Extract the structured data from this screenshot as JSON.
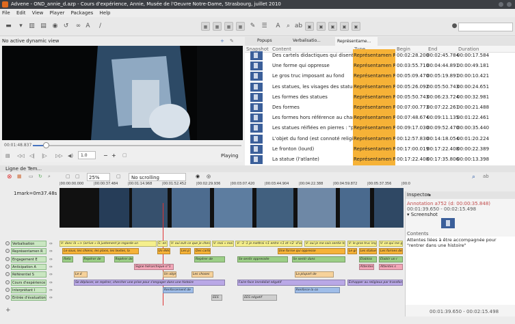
{
  "window": {
    "title": "Advene - OND_annie_d.azp - Cours d'expérience, Annie, Musée de l'Oeuvre Notre-Dame, Strasbourg, juillet 2010"
  },
  "menu": [
    "File",
    "Edit",
    "View",
    "Player",
    "Packages",
    "Help"
  ],
  "dynamic_view": "No active dynamic view",
  "tabs": {
    "popups": "Popups",
    "verbalisation": "Verbalisatio...",
    "representation": "Représentame..."
  },
  "video": {
    "time": "00:01:48.837",
    "rate": "1.0",
    "status": "Playing"
  },
  "annotations_table": {
    "headers": [
      "Snapshot",
      "Content",
      "Type",
      "Begin",
      "End",
      "Duration"
    ],
    "rows": [
      {
        "content": "Des cartels didactiques qui disent de",
        "type": "Représentamen R",
        "begin": "00:02:28.200",
        "end": "00:02:45.784",
        "duration": "00:00:17.584"
      },
      {
        "content": "Une forme qui oppresse",
        "type": "Représentamen R",
        "begin": "00:03:55.710",
        "end": "00:04:44.891",
        "duration": "00:00:49.181"
      },
      {
        "content": "Le gros truc imposant au fond",
        "type": "Représentamen R",
        "begin": "00:05:09.470",
        "end": "00:05:19.891",
        "duration": "00:00:10.421"
      },
      {
        "content": "Les statues, les visages des statues",
        "type": "Représentamen R",
        "begin": "00:05:26.092",
        "end": "00:05:50.743",
        "duration": "00:00:24.651"
      },
      {
        "content": "Les formes des statues",
        "type": "Représentamen R",
        "begin": "00:05:50.743",
        "end": "00:06:23.724",
        "duration": "00:00:32.981"
      },
      {
        "content": "Des formes",
        "type": "Représentamen R",
        "begin": "00:07:00.773",
        "end": "00:07:22.261",
        "duration": "00:00:21.488"
      },
      {
        "content": "Les formes hors référence au champ",
        "type": "Représentamen R",
        "begin": "00:07:48.674",
        "end": "00:09:11.135",
        "duration": "00:01:22.461"
      },
      {
        "content": "Les statues réifiées en pierres : \"parc",
        "type": "Représentamen R",
        "begin": "00:09:17.030",
        "end": "00:09:52.470",
        "duration": "00:00:35.440"
      },
      {
        "content": "L'objet du fond (est connoté religieux)",
        "type": "Représentamen R",
        "begin": "00:12:57.830",
        "end": "00:14:18.054",
        "duration": "00:01:20.224"
      },
      {
        "content": "Le fronton (lourd)",
        "type": "Représentamen R",
        "begin": "00:17:00.019",
        "end": "00:17:22.408",
        "duration": "00:00:22.389"
      },
      {
        "content": "La statue (l'atlante)",
        "type": "Représentamen R",
        "begin": "00:17:22.408",
        "end": "00:17:35.806",
        "duration": "00:00:13.398"
      }
    ]
  },
  "timeline": {
    "tab": "Ligne de Tem...",
    "zoom": "25%",
    "scroll_mode": "No scrolling",
    "mark": "1mark=0m37.48s",
    "scale": [
      "|00:00:00.000",
      "|00:00:37.484",
      "|00:01:14.968",
      "|00:01:52.452",
      "|00:02:29.936",
      "|00:03:07.420",
      "|00:03:44.904",
      "|00:04:22.388",
      "|00:04:59.872",
      "|00:05:37.356",
      "|00:0"
    ],
    "tracks": [
      {
        "label": "Verbalisation",
        "color": "#c9e6c1"
      },
      {
        "label": "Représentamen R",
        "color": "#c9e6c1"
      },
      {
        "label": "Engagement E",
        "color": "#c9e6c1"
      },
      {
        "label": "Anticipation A",
        "color": "#c9e6c1"
      },
      {
        "label": "Référentiel S",
        "color": "#c9e6c1"
      },
      {
        "label": "Cours d'expérience CE",
        "color": "#c9e6c1"
      },
      {
        "label": "Interprétant I",
        "color": "#c9e6c1"
      },
      {
        "label": "Entrée d'évaluation des",
        "color": "#c9e6c1"
      }
    ],
    "annotations": [
      {
        "track": 0,
        "text": "V: donc là => (arrive » là justement je regarde un",
        "color": "#f5ef8c",
        "start": 0,
        "end": 17
      },
      {
        "track": 0,
        "text": "C: en",
        "color": "#f5ef8c",
        "start": 17,
        "end": 19
      },
      {
        "track": 0,
        "text": "V: oui euh ce que je cherche au",
        "color": "#f5ef8c",
        "start": 19.2,
        "end": 26.5
      },
      {
        "track": 0,
        "text": "V: moi » moi",
        "color": "#f5ef8c",
        "start": 26.6,
        "end": 30.5
      },
      {
        "track": 0,
        "text": "V: -3 -1 je mettrai <1 entre <1 et <2 -d'accord> voilà",
        "color": "#f5ef8c",
        "start": 30.7,
        "end": 42.5
      },
      {
        "track": 0,
        "text": "V: oui je me sais sentie tout de",
        "color": "#f5ef8c",
        "start": 42.7,
        "end": 50
      },
      {
        "track": 0,
        "text": "V: le gros truc imposant",
        "color": "#f5ef8c",
        "start": 50.2,
        "end": 55.5
      },
      {
        "track": 0,
        "text": "V: ce qui me guide",
        "color": "#f5ef8c",
        "start": 55.7,
        "end": 60
      },
      {
        "track": 1,
        "text": "Le sous, les chiens, les plans, les textes, la",
        "color": "#f6b237",
        "start": 0.5,
        "end": 14
      },
      {
        "track": 1,
        "text": "Un élém",
        "color": "#f6b237",
        "start": 17,
        "end": 19.5
      },
      {
        "track": 1,
        "text": "Les p",
        "color": "#f6b237",
        "start": 21,
        "end": 23
      },
      {
        "track": 1,
        "text": "Des cartels",
        "color": "#f6b237",
        "start": 23.5,
        "end": 26.5
      },
      {
        "track": 1,
        "text": "Une forme qui oppresse",
        "color": "#f6b237",
        "start": 38,
        "end": 50
      },
      {
        "track": 1,
        "text": "Le gr",
        "color": "#f6b237",
        "start": 50.2,
        "end": 52
      },
      {
        "track": 1,
        "text": "Les statues, le",
        "color": "#f6b237",
        "start": 52.2,
        "end": 55.5
      },
      {
        "track": 1,
        "text": "Les formes des sta",
        "color": "#f6b237",
        "start": 55.7,
        "end": 60
      },
      {
        "track": 2,
        "text": "Reto",
        "color": "#9ccf87",
        "start": 0.5,
        "end": 2.5
      },
      {
        "track": 2,
        "text": "Repérer de",
        "color": "#9ccf87",
        "start": 4,
        "end": 8
      },
      {
        "track": 2,
        "text": "Repérer des",
        "color": "#9ccf87",
        "start": 9.5,
        "end": 13
      },
      {
        "track": 2,
        "text": "Repérer de",
        "color": "#9ccf87",
        "start": 23.5,
        "end": 29
      },
      {
        "track": 2,
        "text": "Se sentir oppressée",
        "color": "#9ccf87",
        "start": 31,
        "end": 40
      },
      {
        "track": 2,
        "text": "Se sentir dans",
        "color": "#9ccf87",
        "start": 40.5,
        "end": 50
      },
      {
        "track": 2,
        "text": "Établiss",
        "color": "#9ccf87",
        "start": 52.2,
        "end": 55.5
      },
      {
        "track": 2,
        "text": "Établir un r",
        "color": "#9ccf87",
        "start": 55.7,
        "end": 60
      },
      {
        "track": 3,
        "text": "Signe hiérarchique n°1",
        "color": "#f2a6b8",
        "start": 13,
        "end": 20
      },
      {
        "track": 3,
        "text": "Attentes",
        "color": "#f2a6b8",
        "start": 52.2,
        "end": 55
      },
      {
        "track": 3,
        "text": "Attentes s",
        "color": "#f2a6b8",
        "start": 55.7,
        "end": 60
      },
      {
        "track": 4,
        "text": "Le d",
        "color": "#f6d29b",
        "start": 2.5,
        "end": 5
      },
      {
        "track": 4,
        "text": "Un objet",
        "color": "#f6d29b",
        "start": 18,
        "end": 20.5
      },
      {
        "track": 4,
        "text": "Les choses",
        "color": "#f6d29b",
        "start": 23,
        "end": 27
      },
      {
        "track": 4,
        "text": "La plupart de",
        "color": "#f6d29b",
        "start": 41,
        "end": 48
      },
      {
        "track": 5,
        "text": "Se déplacer, se repérer, chercher une prise pour s'engager dans une histoire",
        "color": "#b9a8e6",
        "start": 2.5,
        "end": 29
      },
      {
        "track": 5,
        "text": "Faire-face immédiat négatif",
        "color": "#b9a8e6",
        "start": 31,
        "end": 50
      },
      {
        "track": 5,
        "text": "Échapper au religieux par transformation",
        "color": "#b9a8e6",
        "start": 50.2,
        "end": 60
      },
      {
        "track": 6,
        "text": "Renforcement de",
        "color": "#9fbde8",
        "start": 18,
        "end": 23.5
      },
      {
        "track": 6,
        "text": "Renforce la co",
        "color": "#9fbde8",
        "start": 41,
        "end": 49
      },
      {
        "track": 7,
        "text": "EES",
        "color": "#cfcfcf",
        "start": 26.5,
        "end": 28.5
      },
      {
        "track": 7,
        "text": "EES négatif",
        "color": "#cfcfcf",
        "start": 32,
        "end": 38
      }
    ]
  },
  "inspector": {
    "title": "Inspector",
    "annotation": "Annotation a752",
    "duration_info": "(d: 00:00:35.848)",
    "range": "00:01:39.650 - 00:02:15.498",
    "screenshot_label": "▾ Screenshot",
    "contents_label": "Contents",
    "contents": "Attentes liées à être accompagnée pour \"rentrer dans une histoire\"",
    "footer_range": "00:01:39.650 - 00:02:15.498"
  },
  "colors": {
    "type_highlight": "#f6b237",
    "track_label": "#c9e6c1",
    "accent": "#3b5f9a"
  }
}
